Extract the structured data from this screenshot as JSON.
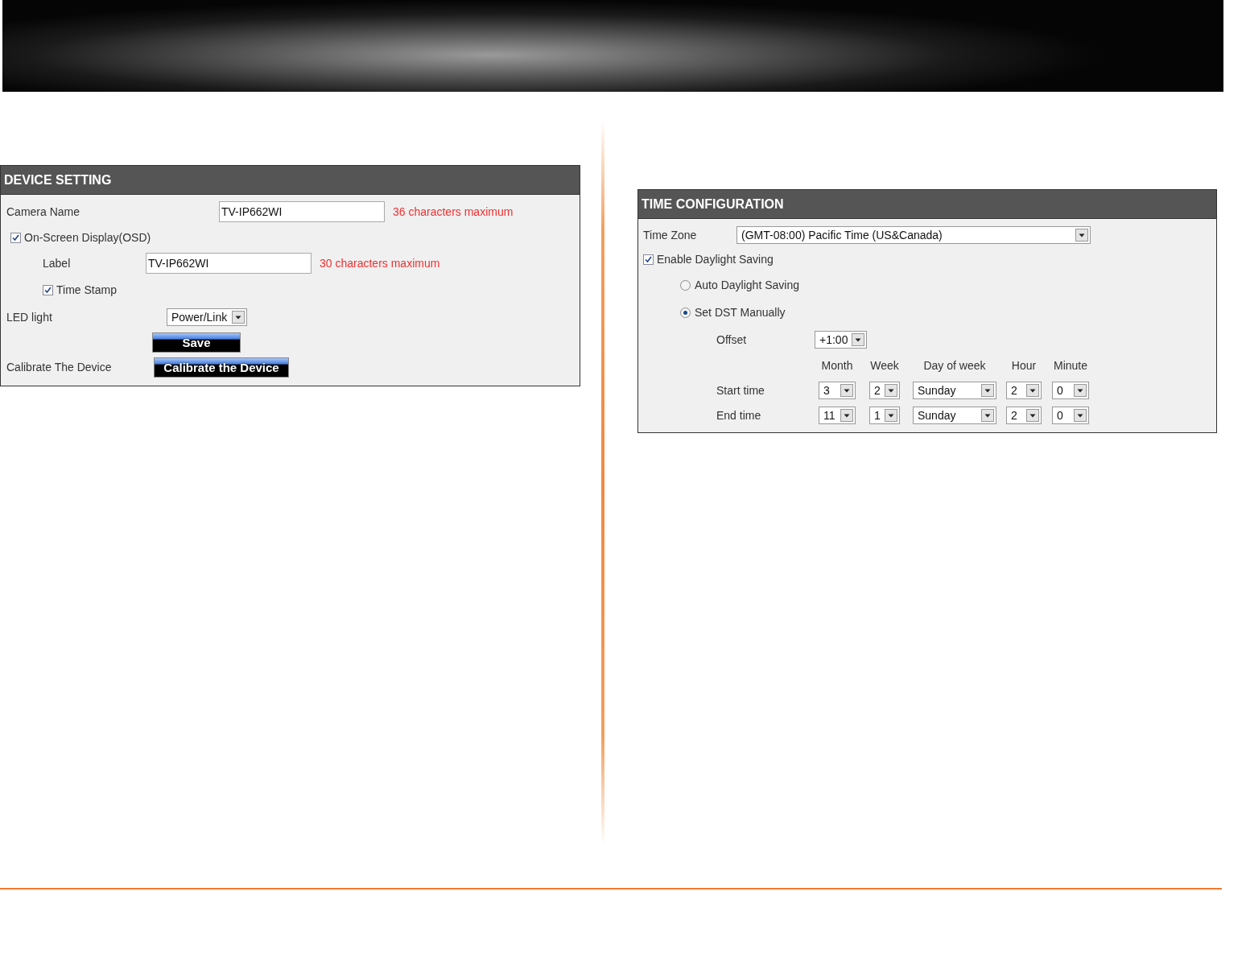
{
  "device_setting": {
    "title": "DEVICE SETTING",
    "camera_name": {
      "label": "Camera Name",
      "value": "TV-IP662WI",
      "hint": "36 characters maximum"
    },
    "osd": {
      "label": "On-Screen Display(OSD)",
      "checked": true
    },
    "osd_label": {
      "label": "Label",
      "value": "TV-IP662WI",
      "hint": "30 characters maximum"
    },
    "time_stamp": {
      "label": "Time Stamp",
      "checked": true
    },
    "led_light": {
      "label": "LED light",
      "value": "Power/Link"
    },
    "save_button": "Save",
    "calibrate": {
      "label": "Calibrate The Device",
      "button": "Calibrate the Device"
    }
  },
  "time_configuration": {
    "title": "TIME CONFIGURATION",
    "time_zone": {
      "label": "Time Zone",
      "value": "(GMT-08:00) Pacific Time (US&Canada)"
    },
    "daylight_saving": {
      "label": "Enable Daylight Saving",
      "checked": true
    },
    "modes": [
      {
        "label": "Auto Daylight Saving",
        "selected": false
      },
      {
        "label": "Set DST Manually",
        "selected": true
      }
    ],
    "offset": {
      "label": "Offset",
      "value": "+1:00"
    },
    "columns": [
      "Month",
      "Week",
      "Day of week",
      "Hour",
      "Minute"
    ],
    "rows": [
      {
        "label": "Start time",
        "values": [
          "3",
          "2",
          "Sunday",
          "2",
          "0"
        ]
      },
      {
        "label": "End time",
        "values": [
          "11",
          "1",
          "Sunday",
          "2",
          "0"
        ]
      }
    ]
  }
}
